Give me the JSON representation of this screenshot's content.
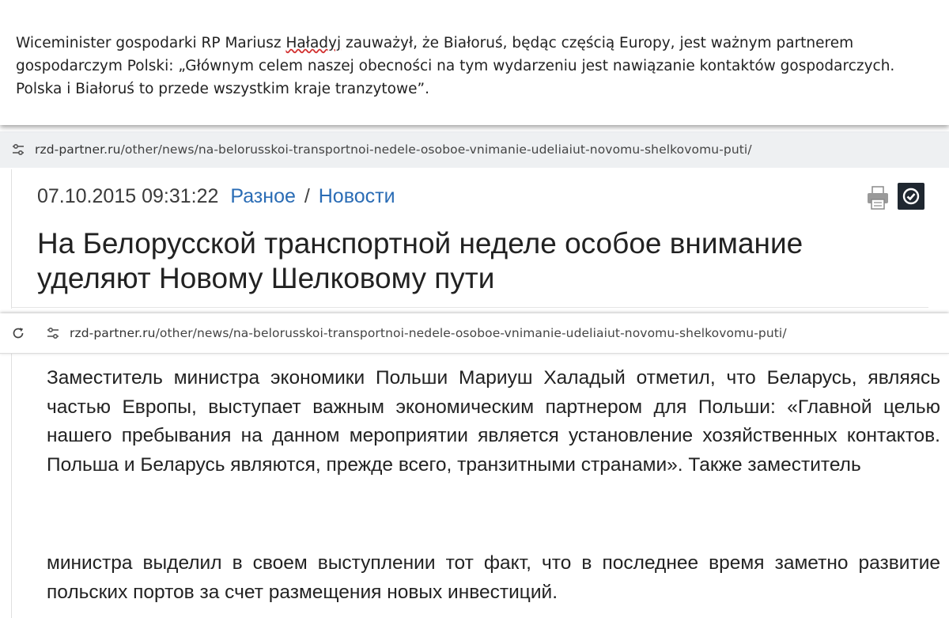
{
  "quote_panel": {
    "text_before": "Wiceminister gospodarki RP Mariusz ",
    "underlined_name": "Haładyj",
    "text_after": " zauważył, że Białoruś, będąc częścią Europy, jest ważnym partnerem gospodarczym Polski: „Głównym celem naszej obecności na tym wydarzeniu jest nawiązanie kontaktów gospodarczych. Polska i Białoruś to przede wszystkim kraje tranzytowe”."
  },
  "address_bar_1": {
    "host": "rzd-partner.ru",
    "path": "/other/news/na-belorusskoi-transportnoi-nedele-osoboe-vnimanie-udeliaiut-novomu-shelkovomu-puti/"
  },
  "article_header": {
    "date": "07.10.2015 09:31:22",
    "category": "Разное",
    "separator": "/",
    "section": "Новости",
    "title": "На Белорусской транспортной неделе особое внимание уделяют Новому Шелковому пути"
  },
  "address_bar_2": {
    "host": "rzd-partner.ru",
    "path": "/other/news/na-belorusskoi-transportnoi-nedele-osoboe-vnimanie-udeliaiut-novomu-shelkovomu-puti/"
  },
  "article_body": {
    "paragraph_1": "Заместитель министра экономики Польши Мариуш Халадый отметил, что Беларусь, являясь частью Европы, выступает важным экономическим партнером для Польши: «Главной целью нашего пребывания на данном мероприятии является установление хозяйственных контактов. Польша и Беларусь являются, прежде всего, транзитными странами». Также заместитель",
    "paragraph_2": "министра выделил в своем выступлении тот факт, что в последнее время заметно развитие польских портов за счет размещения новых инвестиций."
  },
  "icons": {
    "site_info": "tune-icon",
    "reload": "reload-icon",
    "print": "print-icon",
    "check": "check-icon"
  }
}
